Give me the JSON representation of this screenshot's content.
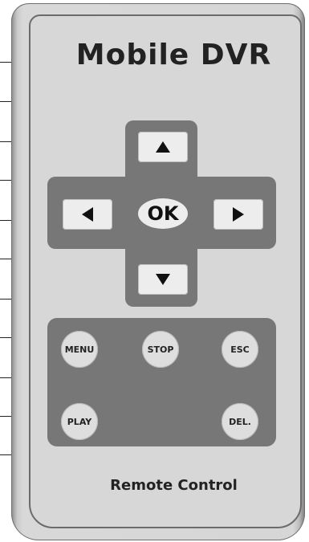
{
  "remote": {
    "title": "Mobile DVR",
    "subtitle": "Remote Control",
    "dpad": {
      "up_icon": "triangle-up-icon",
      "down_icon": "triangle-down-icon",
      "left_icon": "triangle-left-icon",
      "right_icon": "triangle-right-icon",
      "ok_label": "OK"
    },
    "buttons": {
      "menu": "MENU",
      "stop": "STOP",
      "esc": "ESC",
      "play": "PLAY",
      "del": "DEL."
    }
  },
  "colors": {
    "body": "#d7d7d7",
    "pad": "#777777",
    "key": "#ededed",
    "text": "#222222"
  }
}
